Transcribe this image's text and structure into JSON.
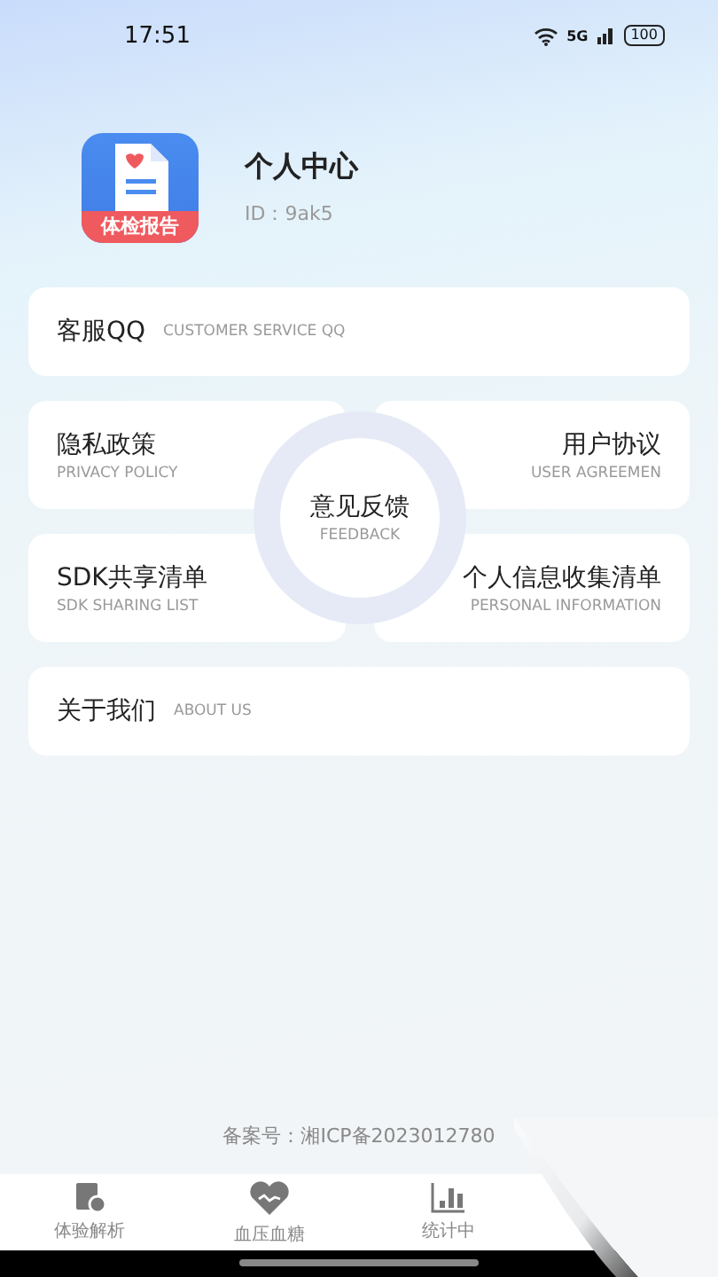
{
  "status_bar": {
    "time": "17:51",
    "network": "5G",
    "battery": "100"
  },
  "profile": {
    "app_icon_label": "体检报告",
    "title": "个人中心",
    "id": "ID：9ak5"
  },
  "menu": [
    {
      "title": "客服QQ",
      "subtitle": "CUSTOMER SERVICE QQ"
    },
    {
      "title": "隐私政策",
      "subtitle": "PRIVACY POLICY"
    },
    {
      "title": "用户协议",
      "subtitle": "USER AGREEMEN"
    },
    {
      "title": "SDK共享清单",
      "subtitle": "SDK SHARING LIST"
    },
    {
      "title": "个人信息收集清单",
      "subtitle": "PERSONAL INFORMATION"
    },
    {
      "title": "关于我们",
      "subtitle": "ABOUT US"
    }
  ],
  "feedback": {
    "title": "意见反馈",
    "subtitle": "FEEDBACK"
  },
  "icp": "备案号：湘ICP备2023012780",
  "tabs": [
    {
      "label": "体验解析",
      "selected": false
    },
    {
      "label": "血压血糖",
      "selected": false
    },
    {
      "label": "统计中",
      "selected": false
    }
  ]
}
